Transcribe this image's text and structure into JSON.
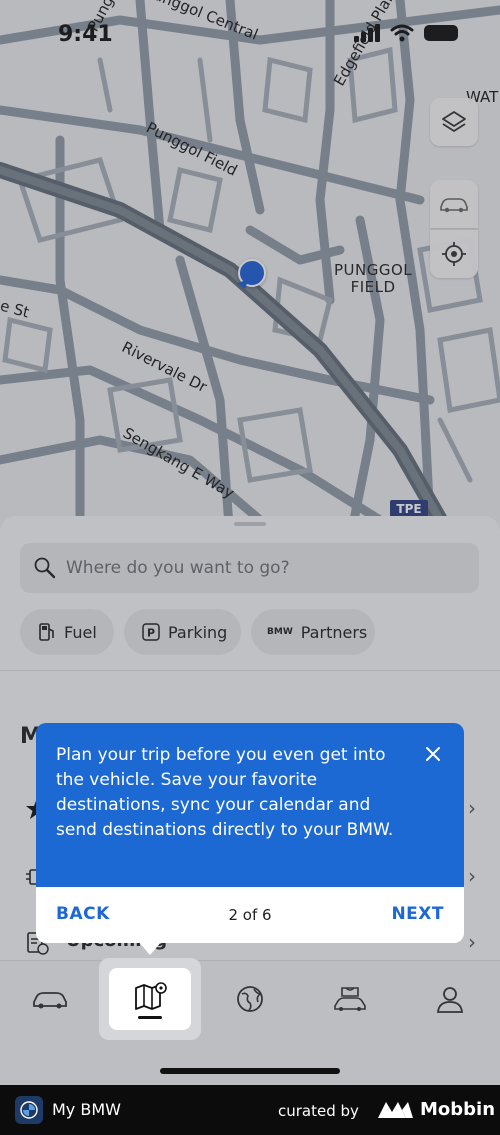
{
  "status_bar": {
    "time": "9:41"
  },
  "map": {
    "street_labels": [
      "Punggol Pl",
      "Punggol Central",
      "Edgefield Plains",
      "WAT",
      "Punggol Field",
      "Rivervale Dr",
      "Sengkang E Way",
      "e St"
    ],
    "district_label_line1": "PUNGGOL",
    "district_label_line2": "FIELD",
    "expressway_badge": "TPE",
    "pin_color": "#1c5fd6"
  },
  "search": {
    "placeholder": "Where do you want to go?"
  },
  "chips": [
    {
      "label": "Fuel",
      "icon": "fuel-pump-icon"
    },
    {
      "label": "Parking",
      "icon": "parking-icon"
    },
    {
      "brand": "BMW",
      "label": "Partners",
      "icon": "bmw-partners-icon"
    }
  ],
  "sheet": {
    "section_letter": "M",
    "upcoming_label": "Upcoming"
  },
  "tooltip": {
    "message": "Plan your trip before you even get into the vehicle. Save your favorite destinations, sync your calendar and send destinations directly to your BMW.",
    "back_label": "BACK",
    "step_label": "2 of 6",
    "next_label": "NEXT",
    "accent_color": "#1c69d4"
  },
  "tabs": [
    {
      "name": "vehicle",
      "icon": "car-icon"
    },
    {
      "name": "map",
      "icon": "map-pin-icon",
      "active": true
    },
    {
      "name": "discover",
      "icon": "globe-icon"
    },
    {
      "name": "shop",
      "icon": "shopping-car-icon"
    },
    {
      "name": "profile",
      "icon": "person-icon"
    }
  ],
  "footer": {
    "app_name": "My BMW",
    "curated_by": "curated by",
    "brand": "Mobbin"
  }
}
